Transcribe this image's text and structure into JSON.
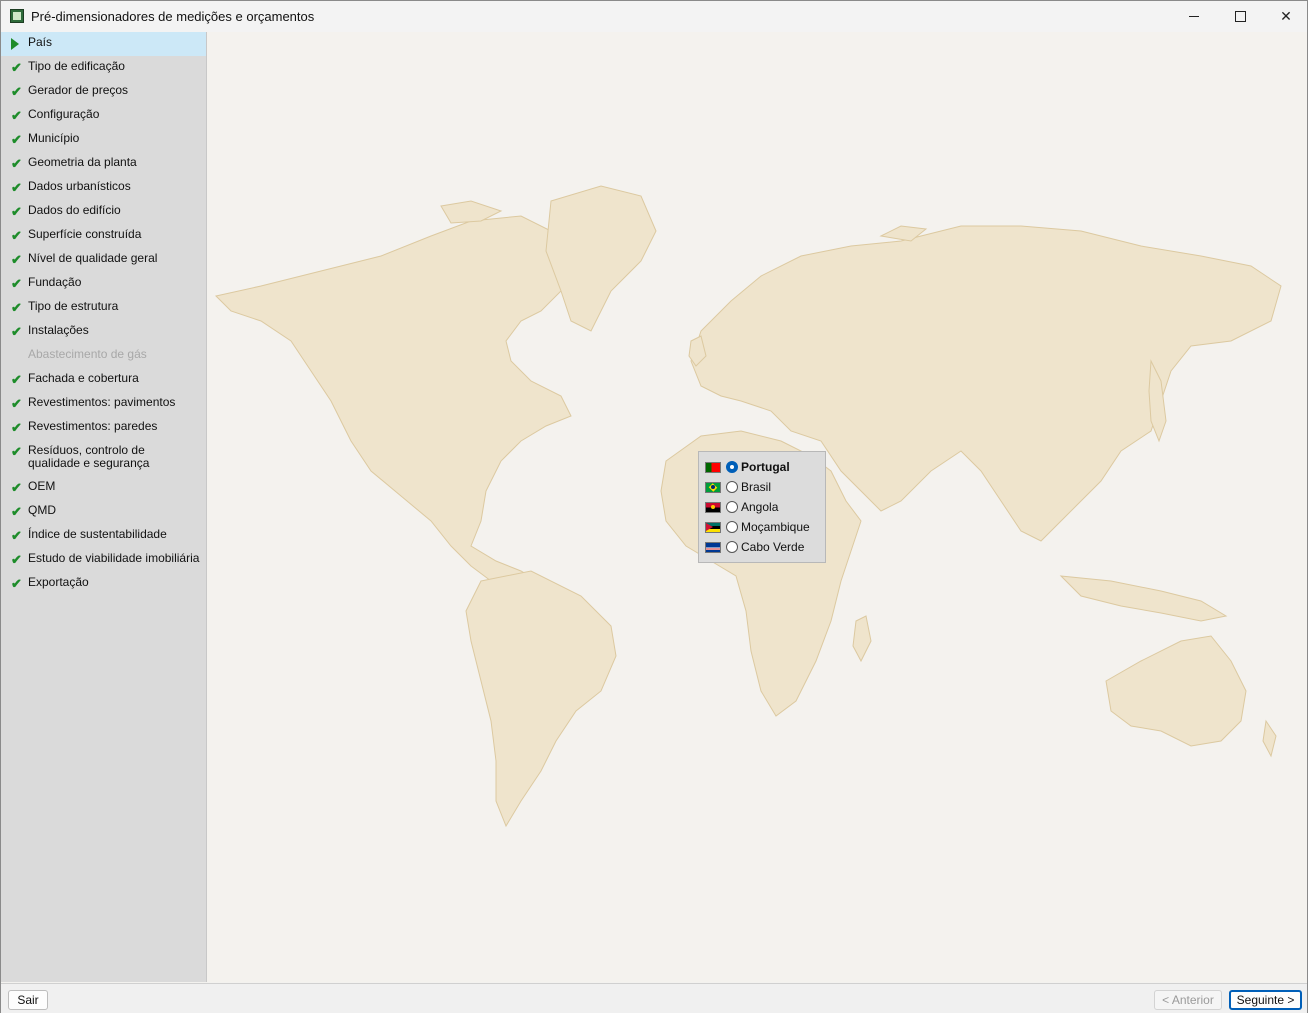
{
  "window": {
    "title": "Pré-dimensionadores de medições e orçamentos"
  },
  "sidebar": {
    "items": [
      {
        "label": "País",
        "state": "current"
      },
      {
        "label": "Tipo de edificação",
        "state": "done"
      },
      {
        "label": "Gerador de preços",
        "state": "done"
      },
      {
        "label": "Configuração",
        "state": "done"
      },
      {
        "label": "Município",
        "state": "done"
      },
      {
        "label": "Geometria da planta",
        "state": "done"
      },
      {
        "label": "Dados urbanísticos",
        "state": "done"
      },
      {
        "label": "Dados do edifício",
        "state": "done"
      },
      {
        "label": "Superfície construída",
        "state": "done"
      },
      {
        "label": "Nível de qualidade geral",
        "state": "done"
      },
      {
        "label": "Fundação",
        "state": "done"
      },
      {
        "label": "Tipo de estrutura",
        "state": "done"
      },
      {
        "label": "Instalações",
        "state": "done"
      },
      {
        "label": "Abastecimento de gás",
        "state": "disabled"
      },
      {
        "label": "Fachada e cobertura",
        "state": "done"
      },
      {
        "label": "Revestimentos: pavimentos",
        "state": "done"
      },
      {
        "label": "Revestimentos: paredes",
        "state": "done"
      },
      {
        "label": "Resíduos, controlo de qualidade e segurança",
        "state": "done"
      },
      {
        "label": "OEM",
        "state": "done"
      },
      {
        "label": "QMD",
        "state": "done"
      },
      {
        "label": "Índice de sustentabilidade",
        "state": "done"
      },
      {
        "label": "Estudo de viabilidade imobiliária",
        "state": "done"
      },
      {
        "label": "Exportação",
        "state": "done"
      }
    ]
  },
  "countries": {
    "selected": "Portugal",
    "options": [
      {
        "label": "Portugal",
        "flag": "portugal-flag",
        "colors": [
          "#006600",
          "#ff0000"
        ]
      },
      {
        "label": "Brasil",
        "flag": "brazil-flag",
        "colors": [
          "#009c3b",
          "#ffdf00",
          "#002776"
        ]
      },
      {
        "label": "Angola",
        "flag": "angola-flag",
        "colors": [
          "#cc092f",
          "#000000",
          "#ffcb00"
        ]
      },
      {
        "label": "Moçambique",
        "flag": "mozambique-flag",
        "colors": [
          "#007168",
          "#000000",
          "#fce100",
          "#d21034"
        ]
      },
      {
        "label": "Cabo Verde",
        "flag": "cape-verde-flag",
        "colors": [
          "#003893",
          "#ffffff",
          "#cf2027"
        ]
      }
    ]
  },
  "buttons": {
    "exit": "Sair",
    "previous": "< Anterior",
    "next": "Seguinte >"
  }
}
